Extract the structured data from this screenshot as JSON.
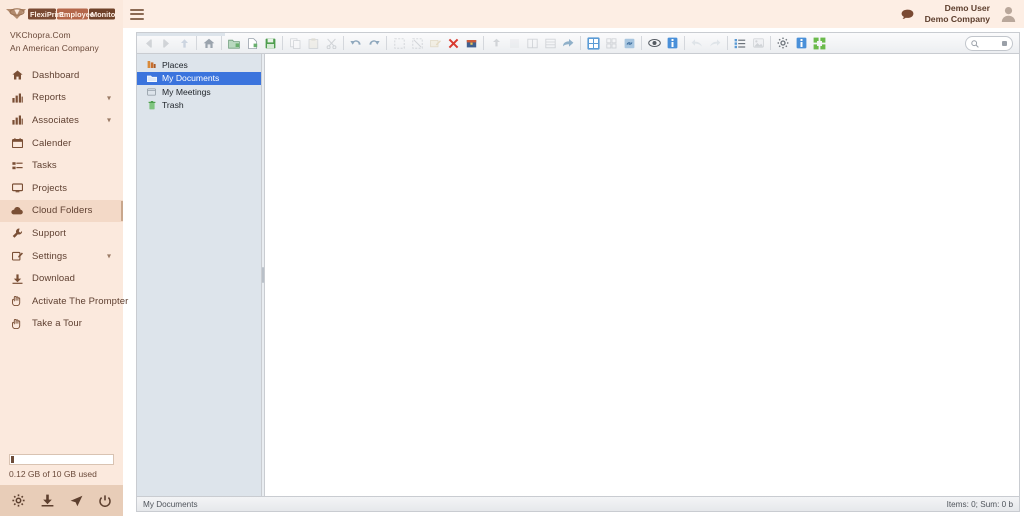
{
  "brand": {
    "logo_text": "FlexiPrint Employee Monitoring",
    "site": "VKChopra.Com",
    "tagline": "An American Company"
  },
  "topbar": {
    "menu_icon": "hamburger-icon",
    "chat_icon": "chat-bubble-icon",
    "avatar_icon": "user-avatar-icon",
    "user_name": "Demo User",
    "user_company": "Demo Company"
  },
  "sidebar": {
    "items": [
      {
        "label": "Dashboard",
        "icon": "home-icon",
        "caret": false,
        "active": false
      },
      {
        "label": "Reports",
        "icon": "chart-icon",
        "caret": true,
        "active": false
      },
      {
        "label": "Associates",
        "icon": "chart-icon",
        "caret": true,
        "active": false
      },
      {
        "label": "Calender",
        "icon": "calendar-icon",
        "caret": false,
        "active": false
      },
      {
        "label": "Tasks",
        "icon": "tasks-icon",
        "caret": false,
        "active": false
      },
      {
        "label": "Projects",
        "icon": "monitor-icon",
        "caret": false,
        "active": false
      },
      {
        "label": "Cloud Folders",
        "icon": "cloud-icon",
        "caret": false,
        "active": true
      },
      {
        "label": "Support",
        "icon": "wrench-icon",
        "caret": false,
        "active": false
      },
      {
        "label": "Settings",
        "icon": "edit-icon",
        "caret": true,
        "active": false
      },
      {
        "label": "Download",
        "icon": "download-icon",
        "caret": false,
        "active": false
      },
      {
        "label": "Activate The Prompter",
        "icon": "hand-icon",
        "caret": false,
        "active": false
      },
      {
        "label": "Take a Tour",
        "icon": "hand-icon",
        "caret": false,
        "active": false
      }
    ],
    "storage": {
      "text": "0.12 GB of 10 GB used",
      "percent": 1.2
    },
    "footer_icons": [
      {
        "name": "gear-icon"
      },
      {
        "name": "download-icon"
      },
      {
        "name": "send-icon"
      },
      {
        "name": "power-icon"
      }
    ]
  },
  "filemanager": {
    "toolbar": [
      {
        "name": "back-icon",
        "state": "disabled"
      },
      {
        "name": "forward-icon",
        "state": "disabled"
      },
      {
        "name": "up-icon",
        "state": "disabled"
      },
      {
        "sep": true
      },
      {
        "name": "home-icon",
        "state": "enabled"
      },
      {
        "sep": true
      },
      {
        "name": "new-folder-icon",
        "state": "enabled"
      },
      {
        "name": "new-file-icon",
        "state": "enabled"
      },
      {
        "name": "save-icon",
        "state": "enabled"
      },
      {
        "sep": true
      },
      {
        "name": "copy-icon",
        "state": "disabled"
      },
      {
        "name": "paste-icon",
        "state": "disabled"
      },
      {
        "name": "cut-icon",
        "state": "disabled"
      },
      {
        "sep": true
      },
      {
        "name": "undo-icon",
        "state": "enabled"
      },
      {
        "name": "redo-icon",
        "state": "enabled"
      },
      {
        "sep": true
      },
      {
        "name": "select-all-icon",
        "state": "disabled"
      },
      {
        "name": "deselect-icon",
        "state": "disabled"
      },
      {
        "name": "rename-icon",
        "state": "disabled"
      },
      {
        "name": "delete-icon",
        "state": "enabled"
      },
      {
        "name": "archive-icon",
        "state": "enabled"
      },
      {
        "sep": true
      },
      {
        "name": "upload-icon",
        "state": "disabled"
      },
      {
        "name": "download-icon",
        "state": "disabled"
      },
      {
        "name": "columns-icon",
        "state": "disabled"
      },
      {
        "name": "list-view-icon",
        "state": "disabled"
      },
      {
        "name": "share-icon",
        "state": "enabled"
      },
      {
        "sep": true
      },
      {
        "name": "grid-view-icon",
        "state": "active"
      },
      {
        "name": "thumbs-view-icon",
        "state": "disabled"
      },
      {
        "name": "link-icon",
        "state": "enabled"
      },
      {
        "sep": true
      },
      {
        "name": "preview-icon",
        "state": "enabled"
      },
      {
        "name": "info-icon",
        "state": "active"
      },
      {
        "sep": true
      },
      {
        "name": "sort-asc-icon",
        "state": "disabled"
      },
      {
        "name": "sort-desc-icon",
        "state": "disabled"
      },
      {
        "sep": true
      },
      {
        "name": "sort-list-icon",
        "state": "enabled"
      },
      {
        "name": "image-icon",
        "state": "disabled"
      },
      {
        "sep": true
      },
      {
        "name": "settings-icon",
        "state": "enabled"
      },
      {
        "name": "help-icon",
        "state": "active"
      },
      {
        "name": "fullscreen-icon",
        "state": "active-green"
      }
    ],
    "search": {
      "placeholder": "",
      "value": "",
      "icon": "search-icon"
    },
    "tree": [
      {
        "label": "Places",
        "icon": "places-icon",
        "selected": false
      },
      {
        "label": "My Documents",
        "icon": "documents-icon",
        "selected": true
      },
      {
        "label": "My Meetings",
        "icon": "meetings-icon",
        "selected": false
      },
      {
        "label": "Trash",
        "icon": "trash-icon",
        "selected": false
      }
    ],
    "status": {
      "path": "My Documents",
      "summary": "Items: 0; Sum: 0 b"
    }
  },
  "colors": {
    "sidebar_bg": "#fbe9dd",
    "sidebar_active": "#f3d9c7",
    "sidebar_footer": "#e8cdb8",
    "topbar_bg": "#fdeee4",
    "tree_bg": "#dde4eb",
    "tree_selected": "#3b74dd",
    "accent_blue": "#3b74dd",
    "accent_green": "#6aba4a",
    "accent_red": "#d93b30",
    "text_brown": "#5f4031"
  }
}
